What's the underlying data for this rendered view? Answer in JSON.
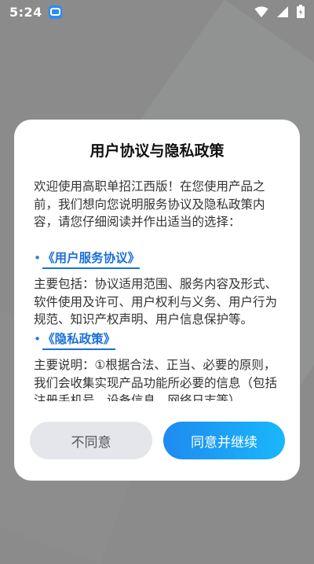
{
  "status_bar": {
    "time": "5:24",
    "icons": [
      "app-notification-icon",
      "wifi-icon",
      "signal-icon",
      "battery-icon"
    ]
  },
  "dialog": {
    "title": "用户协议与隐私政策",
    "intro": "欢迎使用高职单招江西版！在您使用产品之前，我们想向您说明服务协议及隐私政策内容，请您仔细阅读并作出适当的选择：",
    "sections": [
      {
        "link_text": "《用户服务协议》",
        "body": "主要包括：协议适用范围、服务内容及形式、软件使用及许可、用户权利与义务、用户行为规范、知识产权声明、用户信息保护等。"
      },
      {
        "link_text": "《隐私政策》",
        "body": "主要说明：①根据合法、正当、必要的原则，我们会收集实现产品功能所必要的信息（包括注册手机号、设备信息、网络日志等）"
      }
    ],
    "bullet": "•",
    "buttons": {
      "disagree": "不同意",
      "agree": "同意并继续"
    }
  },
  "colors": {
    "link": "#1b6fd9",
    "agree_gradient_start": "#1e8bf0",
    "agree_gradient_end": "#19b7fa",
    "disagree_bg": "#e4e6ec"
  }
}
